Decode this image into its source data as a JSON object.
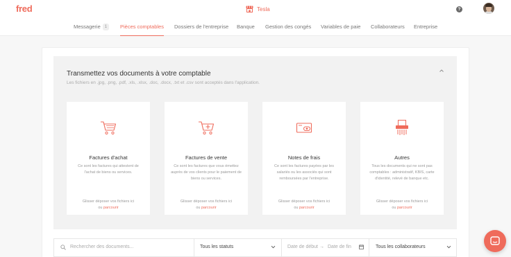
{
  "app": {
    "logo": "fred",
    "company": "Tesla"
  },
  "nav": {
    "items": [
      {
        "label": "Messagerie",
        "badge": "1"
      },
      {
        "label": "Pièces comptables",
        "active": true
      },
      {
        "label": "Dossiers de l'entreprise"
      },
      {
        "label": "Banque"
      },
      {
        "label": "Gestion des congés"
      },
      {
        "label": "Variables de paie"
      },
      {
        "label": "Collaborateurs"
      },
      {
        "label": "Entreprise"
      }
    ]
  },
  "help_icon": "?",
  "upload": {
    "title": "Transmettez vos documents à votre comptable",
    "subtitle": "Les fichiers en .jpg, .png, .pdf, .xls, .xlsx, .doc, .docx, .txt et .csv sont acceptés dans l'application.",
    "cards": [
      {
        "icon": "cart-icon",
        "title": "Factures d'achat",
        "desc": "Ce sont les factures qui attestent de l'achat de biens ou services.",
        "drop": "Glisser déposer vos fichiers ici",
        "or": "ou",
        "link": "parcourir"
      },
      {
        "icon": "cart-plus-icon",
        "title": "Factures de vente",
        "desc": "Ce sont les factures que vous émettez auprès de vos clients pour le paiement de biens ou services.",
        "drop": "Glisser déposer vos fichiers ici",
        "or": "ou",
        "link": "parcourir"
      },
      {
        "icon": "cash-icon",
        "title": "Notes de frais",
        "desc": "Ce sont les factures payées par les salariés ou les associés qui sont remboursées par l'entreprise.",
        "drop": "Glisser déposer vos fichiers ici",
        "or": "ou",
        "link": "parcourir"
      },
      {
        "icon": "shredder-icon",
        "title": "Autres",
        "desc": "Tous les documents qui ne sont pas comptables : administratif, KBIS, carte d'identité, relevé de banque etc.",
        "drop": "Glisser déposer vos fichiers ici",
        "or": "ou",
        "link": "parcourir"
      }
    ]
  },
  "filters": {
    "search_placeholder": "Rechercher des documents...",
    "status": "Tous les statuts",
    "date_start": "Date de début",
    "date_end": "Date de fin",
    "collaborators": "Tous les collaborateurs"
  },
  "colors": {
    "accent": "#ef6b5b",
    "panel": "#f2f2f2"
  }
}
